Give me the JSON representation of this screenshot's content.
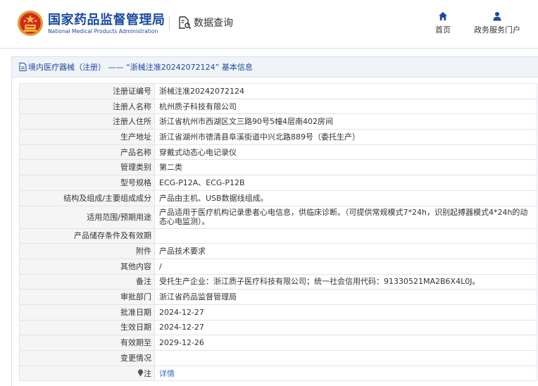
{
  "header": {
    "title_cn": "国家药品监督管理局",
    "title_en": "National Medical Products Administration",
    "query_label": "数据查询",
    "nav": {
      "home": "首页",
      "gov": "政务服务门户"
    }
  },
  "breadcrumb": "境内医疗器械（注册） —— “浙械注准20242072124” 基本信息",
  "rows": [
    {
      "label": "注册证编号",
      "value": "浙械注准20242072124"
    },
    {
      "label": "注册人名称",
      "value": "杭州质子科技有限公司"
    },
    {
      "label": "注册人住所",
      "value": "浙江省杭州市西湖区文三路90号5幢4层南402房间"
    },
    {
      "label": "生产地址",
      "value": "浙江省湖州市德清县阜溪街道中兴北路889号（委托生产）"
    },
    {
      "label": "产品名称",
      "value": "穿戴式动态心电记录仪"
    },
    {
      "label": "管理类别",
      "value": "第二类"
    },
    {
      "label": "型号规格",
      "value": "ECG-P12A、ECG-P12B"
    },
    {
      "label": "结构及组成/主要组成成分",
      "value": "产品由主机、USB数据线组成。"
    },
    {
      "label": "适用范围/预期用途",
      "value": "产品适用于医疗机构记录患者心电信息，供临床诊断。（可提供常规模式7*24h，识别起搏器模式4*24h的动态心电监测）。"
    },
    {
      "label": "产品储存条件及有效期",
      "value": ""
    },
    {
      "label": "附件",
      "value": "产品技术要求"
    },
    {
      "label": "其他内容",
      "value": "/"
    },
    {
      "label": "备注",
      "value": "受托生产企业：浙江质子医疗科技有限公司；统一社会信用代码：91330521MA2B6X4L0J。"
    },
    {
      "label": "审批部门",
      "value": "浙江省药品监督管理局"
    },
    {
      "label": "批准日期",
      "value": "2024-12-27"
    },
    {
      "label": "生效日期",
      "value": "2024-12-27"
    },
    {
      "label": "有效期至",
      "value": "2029-12-26"
    },
    {
      "label": "变更情况",
      "value": ""
    }
  ],
  "note": {
    "label": "注",
    "value": "详情"
  }
}
